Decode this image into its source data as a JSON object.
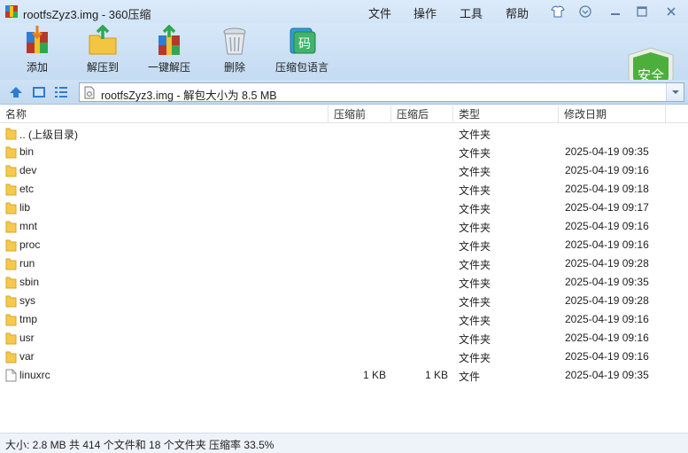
{
  "window": {
    "title": "rootfsZyz3.img - 360压缩"
  },
  "menu": {
    "file": "文件",
    "ops": "操作",
    "tools": "工具",
    "help": "帮助"
  },
  "toolbar": {
    "add": "添加",
    "extract_to": "解压到",
    "one_click": "一键解压",
    "delete": "删除",
    "lang": "压缩包语言"
  },
  "security": {
    "label": "安全",
    "icon_char": "码"
  },
  "address": {
    "text": "rootfsZyz3.img - 解包大小为 8.5 MB"
  },
  "columns": {
    "name": "名称",
    "before": "压缩前",
    "after": "压缩后",
    "type": "类型",
    "modified": "修改日期"
  },
  "files": [
    {
      "name": ".. (上级目录)",
      "before": "",
      "after": "",
      "type": "文件夹",
      "modified": "",
      "kind": "folder"
    },
    {
      "name": "bin",
      "before": "",
      "after": "",
      "type": "文件夹",
      "modified": "2025-04-19 09:35",
      "kind": "folder"
    },
    {
      "name": "dev",
      "before": "",
      "after": "",
      "type": "文件夹",
      "modified": "2025-04-19 09:16",
      "kind": "folder"
    },
    {
      "name": "etc",
      "before": "",
      "after": "",
      "type": "文件夹",
      "modified": "2025-04-19 09:18",
      "kind": "folder"
    },
    {
      "name": "lib",
      "before": "",
      "after": "",
      "type": "文件夹",
      "modified": "2025-04-19 09:17",
      "kind": "folder"
    },
    {
      "name": "mnt",
      "before": "",
      "after": "",
      "type": "文件夹",
      "modified": "2025-04-19 09:16",
      "kind": "folder"
    },
    {
      "name": "proc",
      "before": "",
      "after": "",
      "type": "文件夹",
      "modified": "2025-04-19 09:16",
      "kind": "folder"
    },
    {
      "name": "run",
      "before": "",
      "after": "",
      "type": "文件夹",
      "modified": "2025-04-19 09:28",
      "kind": "folder"
    },
    {
      "name": "sbin",
      "before": "",
      "after": "",
      "type": "文件夹",
      "modified": "2025-04-19 09:35",
      "kind": "folder"
    },
    {
      "name": "sys",
      "before": "",
      "after": "",
      "type": "文件夹",
      "modified": "2025-04-19 09:28",
      "kind": "folder"
    },
    {
      "name": "tmp",
      "before": "",
      "after": "",
      "type": "文件夹",
      "modified": "2025-04-19 09:16",
      "kind": "folder"
    },
    {
      "name": "usr",
      "before": "",
      "after": "",
      "type": "文件夹",
      "modified": "2025-04-19 09:16",
      "kind": "folder"
    },
    {
      "name": "var",
      "before": "",
      "after": "",
      "type": "文件夹",
      "modified": "2025-04-19 09:16",
      "kind": "folder"
    },
    {
      "name": "linuxrc",
      "before": "1 KB",
      "after": "1 KB",
      "type": "文件",
      "modified": "2025-04-19 09:35",
      "kind": "file"
    }
  ],
  "status": {
    "text": "大小: 2.8 MB 共 414 个文件和 18 个文件夹 压缩率 33.5%"
  },
  "colors": {
    "accent": "#1e6fc3",
    "security_green": "#4caf3c",
    "folder": "#f6c94e"
  }
}
